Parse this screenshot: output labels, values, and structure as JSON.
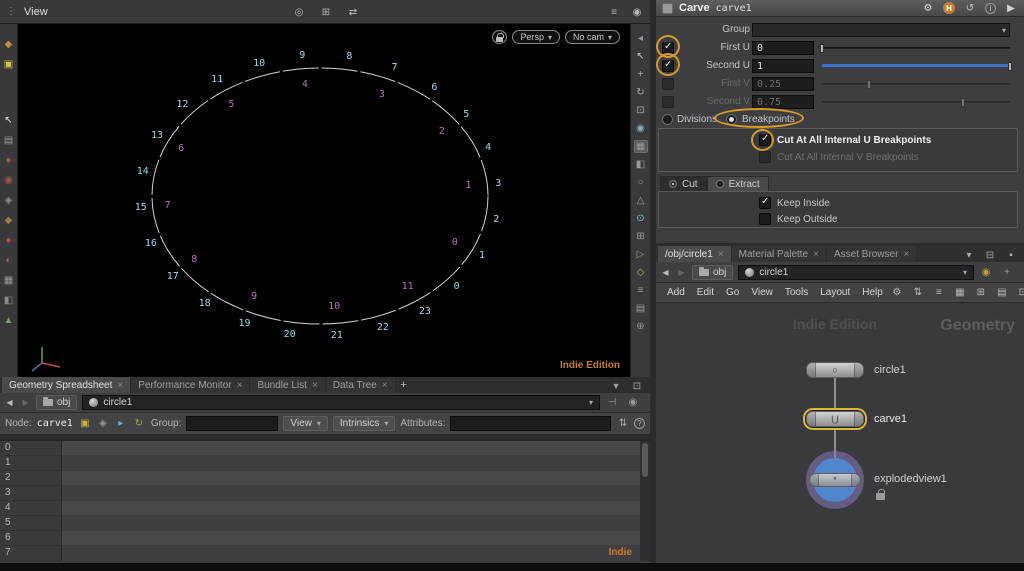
{
  "colors": {
    "brand_orange": "#c97e2e",
    "selection_yellow": "#d8b93c",
    "template_purple": "#8a79c0",
    "display_blue": "#4f86cc"
  },
  "glyphs": {
    "grip": "⋮",
    "caret_down": "▾",
    "back": "◀",
    "forward": "▶",
    "close": "×",
    "check": "✓"
  },
  "viewport": {
    "header": {
      "title": "View"
    },
    "overlay": {
      "persp_label": "Persp",
      "no_cam_label": "No cam"
    },
    "watermark": "Indie Edition",
    "point_labels": [
      "0",
      "1",
      "2",
      "3",
      "4",
      "5",
      "6",
      "7",
      "8",
      "9",
      "10",
      "11",
      "12",
      "13",
      "14",
      "15",
      "16",
      "17",
      "18",
      "19",
      "20",
      "21",
      "22",
      "23"
    ],
    "prim_labels": [
      "0",
      "1",
      "2",
      "3",
      "4",
      "5",
      "6",
      "7",
      "8",
      "9",
      "10",
      "11"
    ],
    "colors": {
      "points": "#9fdcec",
      "prims": "#c06cc0",
      "curve": "#d4d4d4"
    }
  },
  "spreadsheet": {
    "tabs": [
      {
        "label": "Geometry Spreadsheet"
      },
      {
        "label": "Performance Monitor"
      },
      {
        "label": "Bundle List"
      },
      {
        "label": "Data Tree"
      }
    ],
    "new_tab_label": "+",
    "path": {
      "root": "obj",
      "node": "circle1"
    },
    "node_row": {
      "node_label": "Node:",
      "node_name": "carve1",
      "group_label": "Group:",
      "group_value": "",
      "view_label": "View",
      "intrinsics_label": "Intrinsics",
      "attributes_label": "Attributes:",
      "attributes_value": ""
    },
    "row_numbers": [
      "0",
      "1",
      "2",
      "3",
      "4",
      "5",
      "6",
      "7"
    ],
    "watermark": "Indie"
  },
  "params": {
    "header": {
      "type_label": "Carve",
      "node_name": "carve1"
    },
    "group": {
      "label": "Group",
      "value": ""
    },
    "first_u": {
      "label": "First U",
      "value": "0",
      "slider": 0,
      "checked": true,
      "enabled": true
    },
    "second_u": {
      "label": "Second U",
      "value": "1",
      "slider": 1,
      "checked": true,
      "enabled": true
    },
    "first_v": {
      "label": "First V",
      "value": "0.25",
      "slider": 0.25,
      "checked": false,
      "enabled": false
    },
    "second_v": {
      "label": "Second V",
      "value": "0.75",
      "slider": 0.75,
      "checked": false,
      "enabled": false
    },
    "radio": {
      "divisions_label": "Divisions",
      "breakpoints_label": "Breakpoints",
      "selected": "Breakpoints"
    },
    "cut_u": {
      "label": "Cut At All Internal U Breakpoints",
      "checked": true,
      "enabled": true
    },
    "cut_v": {
      "label": "Cut At All Internal V Breakpoints",
      "checked": false,
      "enabled": false
    },
    "mode": {
      "cut_label": "Cut",
      "extract_label": "Extract",
      "selected": "Cut"
    },
    "keep_inside": {
      "label": "Keep Inside",
      "checked": true
    },
    "keep_outside": {
      "label": "Keep Outside",
      "checked": false
    },
    "accent_colors": {
      "slider_blue": "#3d6ed0",
      "annotation_orange": "#d89a28"
    }
  },
  "network": {
    "tabs": [
      {
        "label": "/obj/circle1"
      },
      {
        "label": "Material Palette"
      },
      {
        "label": "Asset Browser"
      }
    ],
    "path": {
      "root": "obj",
      "node": "circle1"
    },
    "menu": [
      "Add",
      "Edit",
      "Go",
      "View",
      "Tools",
      "Layout",
      "Help"
    ],
    "watermark": "Indie Edition",
    "context_label": "Geometry",
    "node_glyphs": {
      "circle": "○",
      "carve": "⋃",
      "exploded": "*"
    },
    "nodes": [
      {
        "name": "circle1"
      },
      {
        "name": "carve1",
        "selected": true
      },
      {
        "name": "explodedview1",
        "template": true
      }
    ]
  },
  "icon_sets": {
    "left_toolbar": [
      {
        "name": "shelf-drop-icon",
        "glyph": "◆",
        "color": "#cd8a33"
      },
      {
        "name": "shelf-box-icon",
        "glyph": "▣",
        "color": "#d7c13c"
      },
      {
        "name": "select-cursor-icon",
        "glyph": "↖",
        "color": "#e6e6e6",
        "gap": 36
      },
      {
        "name": "secure-selection-icon",
        "glyph": "▤",
        "color": "#9a9a9a"
      },
      {
        "name": "pose-icon",
        "glyph": "●",
        "color": "#b8503e"
      },
      {
        "name": "character-icon",
        "glyph": "◉",
        "color": "#a8524a"
      },
      {
        "name": "hand-icon",
        "glyph": "◈",
        "color": "#8f8f8f"
      },
      {
        "name": "paint-icon",
        "glyph": "◆",
        "color": "#a3783c"
      },
      {
        "name": "sculpt-icon",
        "glyph": "●",
        "color": "#c04848"
      },
      {
        "name": "clip-icon",
        "glyph": "◐",
        "color": "#b05a68"
      },
      {
        "name": "view-tool-icon",
        "glyph": "▦",
        "color": "#9a9a9a"
      },
      {
        "name": "snap-tool-icon",
        "glyph": "◧",
        "color": "#8a8a8a"
      },
      {
        "name": "render-region-icon",
        "glyph": "▲",
        "color": "#76a05a"
      }
    ],
    "vp_toolbar": [
      {
        "name": "collapse-strip-icon",
        "glyph": "◂",
        "color": "#999999"
      },
      {
        "name": "select-icon",
        "glyph": "↖",
        "color": "#cccccc"
      },
      {
        "name": "translate-icon",
        "glyph": "+",
        "color": "#aaaaaa"
      },
      {
        "name": "rotate-icon",
        "glyph": "↻",
        "color": "#aaaaaa"
      },
      {
        "name": "scale-icon",
        "glyph": "⊡",
        "color": "#aaaaaa"
      },
      {
        "name": "snap-icon",
        "glyph": "◉",
        "color": "#8fb3ba"
      },
      {
        "name": "grid-icon",
        "glyph": "▦",
        "color": "#9a9a9a",
        "selected": true
      },
      {
        "name": "shade-icon",
        "glyph": "◧",
        "color": "#9a9a9a"
      },
      {
        "name": "wireframe-icon",
        "glyph": "○",
        "color": "#9a9a9a"
      },
      {
        "name": "normals-icon",
        "glyph": "△",
        "color": "#9a9a9a"
      },
      {
        "name": "points-display-icon",
        "glyph": "⊙",
        "color": "#7fc3cf"
      },
      {
        "name": "prims-display-icon",
        "glyph": "⊞",
        "color": "#9a9a9a"
      },
      {
        "name": "camera-icon",
        "glyph": "▷",
        "color": "#9a9a9a"
      },
      {
        "name": "light-icon",
        "glyph": "◇",
        "color": "#c9b36a"
      },
      {
        "name": "fog-icon",
        "glyph": "≡",
        "color": "#9a9a9a"
      },
      {
        "name": "background-icon",
        "glyph": "▤",
        "color": "#9a9a9a"
      },
      {
        "name": "options-icon",
        "glyph": "⊕",
        "color": "#9a9a9a"
      }
    ],
    "vp_header_mid": [
      {
        "name": "layout-single-icon",
        "glyph": "◎",
        "color": "#b9b9b9"
      },
      {
        "name": "layout-quad-icon",
        "glyph": "⊞",
        "color": "#b9b9b9"
      },
      {
        "name": "swap-layout-icon",
        "glyph": "⇄",
        "color": "#b9b9b9"
      }
    ],
    "vp_header_right": [
      {
        "name": "display-options-icon",
        "glyph": "≡",
        "color": "#b9b9b9"
      },
      {
        "name": "viewport-menu-icon",
        "glyph": "◉",
        "color": "#b9b9b9"
      }
    ],
    "params_header": [
      {
        "name": "gear-icon",
        "glyph": "⚙",
        "color": "#d8d8d8"
      },
      {
        "name": "houdini-badge-icon",
        "glyph": "H",
        "badge": true
      },
      {
        "name": "history-icon",
        "glyph": "↺",
        "color": "#c9c9c9"
      },
      {
        "name": "info-icon",
        "glyph": "i",
        "circled": true,
        "color": "#c9c9c9"
      },
      {
        "name": "expand-icon",
        "glyph": "▶",
        "color": "#d8d8d8"
      }
    ],
    "sheet_tab_right": [
      {
        "name": "pane-menu-icon",
        "glyph": "▾",
        "color": "#aaaaaa"
      },
      {
        "name": "pane-max-icon",
        "glyph": "⊡",
        "color": "#aaaaaa"
      }
    ],
    "sheet_path_right": [
      {
        "name": "pin-icon",
        "glyph": "⊣",
        "color": "#999999"
      },
      {
        "name": "link-icon",
        "glyph": "◉",
        "color": "#999999"
      }
    ],
    "sheet_node_left": [
      {
        "name": "template-flag-icon",
        "glyph": "▣",
        "color": "#c9b13a"
      },
      {
        "name": "bypass-flag-icon",
        "glyph": "◈",
        "color": "#999999"
      },
      {
        "name": "pointer-mode-icon",
        "glyph": "▸",
        "color": "#7fa7c9"
      },
      {
        "name": "refresh-icon",
        "glyph": "↻",
        "color": "#8fae62"
      }
    ],
    "sheet_node_right": [
      {
        "name": "sort-icon",
        "glyph": "⇅",
        "color": "#aaaaaa"
      },
      {
        "name": "help-icon",
        "glyph": "?",
        "circled": true,
        "color": "#aaaaaa"
      }
    ],
    "network_tab_right": [
      {
        "name": "tab-menu-icon",
        "glyph": "▾",
        "color": "#aaaaaa"
      },
      {
        "name": "pane-split-icon",
        "glyph": "⊟",
        "color": "#aaaaaa"
      },
      {
        "name": "pane-close-icon",
        "glyph": "▪",
        "color": "#aaaaaa"
      }
    ],
    "network_path_right": [
      {
        "name": "display-badge-icon",
        "glyph": "◉",
        "color": "#c9a23a"
      },
      {
        "name": "filter-icon",
        "glyph": "+",
        "color": "#999999"
      }
    ],
    "network_menu_right": [
      {
        "name": "net-tools-icon",
        "glyph": "⚙",
        "color": "#b9b9b9"
      },
      {
        "name": "net-align-icon",
        "glyph": "⇅",
        "color": "#b9b9b9"
      },
      {
        "name": "net-tree-icon",
        "glyph": "≡",
        "color": "#b9b9b9"
      },
      {
        "name": "net-thumb-icon",
        "glyph": "▦",
        "color": "#b9b9b9"
      },
      {
        "name": "net-snap-icon",
        "glyph": "⊞",
        "color": "#b9b9b9"
      },
      {
        "name": "net-list-icon",
        "glyph": "▤",
        "color": "#b9b9b9"
      },
      {
        "name": "net-map-icon",
        "glyph": "⊡",
        "color": "#b9b9b9"
      }
    ]
  }
}
